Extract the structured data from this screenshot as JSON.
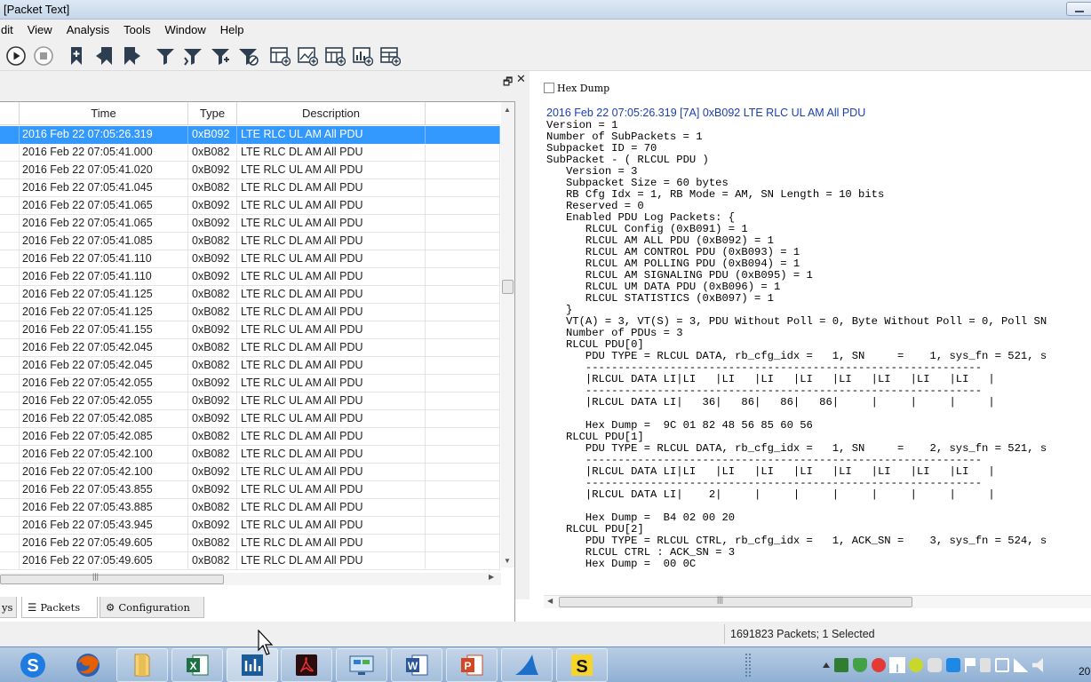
{
  "window": {
    "title": "[Packet Text]"
  },
  "menu": [
    "dit",
    "View",
    "Analysis",
    "Tools",
    "Window",
    "Help"
  ],
  "toolbar": {
    "icons": [
      "play-icon",
      "stop-icon",
      "add-bookmark-icon",
      "prev-bookmark-icon",
      "next-bookmark-icon",
      "filter-icon",
      "filter-add-icon",
      "filter-next-icon",
      "filter-clear-icon",
      "new-table-window-icon",
      "new-graph-window-icon",
      "new-map-window-icon",
      "new-chart-window-icon",
      "new-custom-window-icon"
    ]
  },
  "packet_table": {
    "columns": [
      "Time",
      "Type",
      "Description"
    ],
    "rows": [
      {
        "time": "2016 Feb 22  07:05:26.319",
        "type": "0xB092",
        "desc": "LTE RLC UL AM All PDU",
        "selected": true
      },
      {
        "time": "2016 Feb 22  07:05:41.000",
        "type": "0xB082",
        "desc": "LTE RLC DL AM All PDU"
      },
      {
        "time": "2016 Feb 22  07:05:41.020",
        "type": "0xB092",
        "desc": "LTE RLC UL AM All PDU"
      },
      {
        "time": "2016 Feb 22  07:05:41.045",
        "type": "0xB082",
        "desc": "LTE RLC DL AM All PDU"
      },
      {
        "time": "2016 Feb 22  07:05:41.065",
        "type": "0xB092",
        "desc": "LTE RLC UL AM All PDU"
      },
      {
        "time": "2016 Feb 22  07:05:41.065",
        "type": "0xB092",
        "desc": "LTE RLC UL AM All PDU"
      },
      {
        "time": "2016 Feb 22  07:05:41.085",
        "type": "0xB082",
        "desc": "LTE RLC DL AM All PDU"
      },
      {
        "time": "2016 Feb 22  07:05:41.110",
        "type": "0xB092",
        "desc": "LTE RLC UL AM All PDU"
      },
      {
        "time": "2016 Feb 22  07:05:41.110",
        "type": "0xB092",
        "desc": "LTE RLC UL AM All PDU"
      },
      {
        "time": "2016 Feb 22  07:05:41.125",
        "type": "0xB082",
        "desc": "LTE RLC DL AM All PDU"
      },
      {
        "time": "2016 Feb 22  07:05:41.125",
        "type": "0xB082",
        "desc": "LTE RLC DL AM All PDU"
      },
      {
        "time": "2016 Feb 22  07:05:41.155",
        "type": "0xB092",
        "desc": "LTE RLC UL AM All PDU"
      },
      {
        "time": "2016 Feb 22  07:05:42.045",
        "type": "0xB082",
        "desc": "LTE RLC DL AM All PDU"
      },
      {
        "time": "2016 Feb 22  07:05:42.045",
        "type": "0xB082",
        "desc": "LTE RLC DL AM All PDU"
      },
      {
        "time": "2016 Feb 22  07:05:42.055",
        "type": "0xB092",
        "desc": "LTE RLC UL AM All PDU"
      },
      {
        "time": "2016 Feb 22  07:05:42.055",
        "type": "0xB092",
        "desc": "LTE RLC UL AM All PDU"
      },
      {
        "time": "2016 Feb 22  07:05:42.085",
        "type": "0xB092",
        "desc": "LTE RLC UL AM All PDU"
      },
      {
        "time": "2016 Feb 22  07:05:42.085",
        "type": "0xB082",
        "desc": "LTE RLC DL AM All PDU"
      },
      {
        "time": "2016 Feb 22  07:05:42.100",
        "type": "0xB082",
        "desc": "LTE RLC DL AM All PDU"
      },
      {
        "time": "2016 Feb 22  07:05:42.100",
        "type": "0xB092",
        "desc": "LTE RLC UL AM All PDU"
      },
      {
        "time": "2016 Feb 22  07:05:43.855",
        "type": "0xB092",
        "desc": "LTE RLC UL AM All PDU"
      },
      {
        "time": "2016 Feb 22  07:05:43.885",
        "type": "0xB082",
        "desc": "LTE RLC DL AM All PDU"
      },
      {
        "time": "2016 Feb 22  07:05:43.945",
        "type": "0xB092",
        "desc": "LTE RLC UL AM All PDU"
      },
      {
        "time": "2016 Feb 22  07:05:49.605",
        "type": "0xB082",
        "desc": "LTE RLC DL AM All PDU"
      },
      {
        "time": "2016 Feb 22  07:05:49.605",
        "type": "0xB082",
        "desc": "LTE RLC DL AM All PDU"
      }
    ]
  },
  "bottom_tabs": [
    "ys",
    "Packets",
    "Configuration"
  ],
  "detail": {
    "hex_dump_label": "Hex Dump",
    "header": "2016 Feb 22  07:05:26.319  [7A]  0xB092  LTE RLC UL AM All PDU",
    "lines": [
      "Version = 1",
      "Number of SubPackets = 1",
      "Subpacket ID = 70",
      "SubPacket - ( RLCUL PDU )",
      "   Version = 3",
      "   Subpacket Size = 60 bytes",
      "   RB Cfg Idx = 1, RB Mode = AM, SN Length = 10 bits",
      "   Reserved = 0",
      "   Enabled PDU Log Packets: {",
      "      RLCUL Config (0xB091) = 1",
      "      RLCUL AM ALL PDU (0xB092) = 1",
      "      RLCUL AM CONTROL PDU (0xB093) = 1",
      "      RLCUL AM POLLING PDU (0xB094) = 1",
      "      RLCUL AM SIGNALING PDU (0xB095) = 1",
      "      RLCUL UM DATA PDU (0xB096) = 1",
      "      RLCUL STATISTICS (0xB097) = 1",
      "   }",
      "   VT(A) = 3, VT(S) = 3, PDU Without Poll = 0, Byte Without Poll = 0, Poll SN",
      "   Number of PDUs = 3",
      "   RLCUL PDU[0]",
      "      PDU TYPE = RLCUL DATA, rb_cfg_idx =   1, SN     =    1, sys_fn = 521, s",
      "      -------------------------------------------------------------",
      "      |RLCUL DATA LI|LI   |LI   |LI   |LI   |LI   |LI   |LI   |LI   |",
      "      -------------------------------------------------------------",
      "      |RLCUL DATA LI|   36|   86|   86|   86|     |     |     |     |",
      "",
      "      Hex Dump =  9C 01 82 48 56 85 60 56",
      "   RLCUL PDU[1]",
      "      PDU TYPE = RLCUL DATA, rb_cfg_idx =   1, SN     =    2, sys_fn = 521, s",
      "      -------------------------------------------------------------",
      "      |RLCUL DATA LI|LI   |LI   |LI   |LI   |LI   |LI   |LI   |LI   |",
      "      -------------------------------------------------------------",
      "      |RLCUL DATA LI|    2|     |     |     |     |     |     |     |",
      "",
      "      Hex Dump =  B4 02 00 20",
      "   RLCUL PDU[2]",
      "      PDU TYPE = RLCUL CTRL, rb_cfg_idx =   1, ACK_SN =    3, sys_fn = 524, s",
      "      RLCUL CTRL : ACK_SN = 3",
      "      Hex Dump =  00 0C"
    ]
  },
  "status": {
    "text": "1691823 Packets; 1 Selected"
  },
  "taskbar": {
    "apps": [
      "sogou-icon",
      "firefox-icon",
      "folder-icon",
      "excel-icon",
      "qcat-icon",
      "acrobat-icon",
      "remote-desktop-icon",
      "word-icon",
      "powerpoint-icon",
      "shark-icon",
      "s-app-icon"
    ],
    "clock": "20"
  },
  "colors": {
    "selection": "#3399ff",
    "header_blue": "#1a3fb3"
  }
}
